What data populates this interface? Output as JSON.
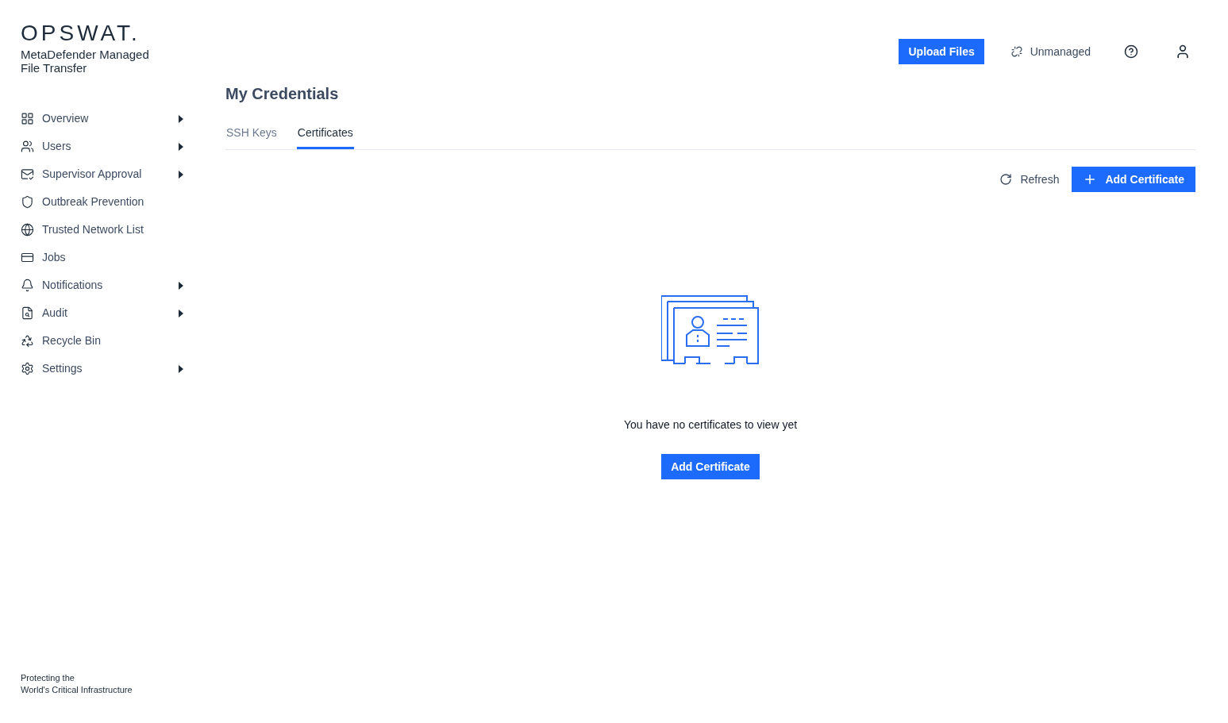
{
  "brand": {
    "logo": "OPSWAT.",
    "product": "MetaDefender Managed File Transfer"
  },
  "sidebar": {
    "items": [
      {
        "label": "Overview",
        "has_submenu": true
      },
      {
        "label": "Users",
        "has_submenu": true
      },
      {
        "label": "Supervisor Approval",
        "has_submenu": true
      },
      {
        "label": "Outbreak Prevention",
        "has_submenu": false
      },
      {
        "label": "Trusted Network List",
        "has_submenu": false
      },
      {
        "label": "Jobs",
        "has_submenu": false
      },
      {
        "label": "Notifications",
        "has_submenu": true
      },
      {
        "label": "Audit",
        "has_submenu": true
      },
      {
        "label": "Recycle Bin",
        "has_submenu": false
      },
      {
        "label": "Settings",
        "has_submenu": true
      }
    ],
    "footer": [
      "Protecting the",
      "World's Critical Infrastructure"
    ]
  },
  "header": {
    "upload_button": "Upload Files",
    "status": "Unmanaged"
  },
  "page": {
    "title": "My Credentials",
    "tabs": [
      {
        "label": "SSH Keys",
        "selected": false
      },
      {
        "label": "Certificates",
        "selected": true
      }
    ],
    "refresh_button": "Refresh",
    "add_button": "Add Certificate",
    "empty_state": {
      "message": "You have no certificates to view yet",
      "button": "Add Certificate"
    }
  }
}
